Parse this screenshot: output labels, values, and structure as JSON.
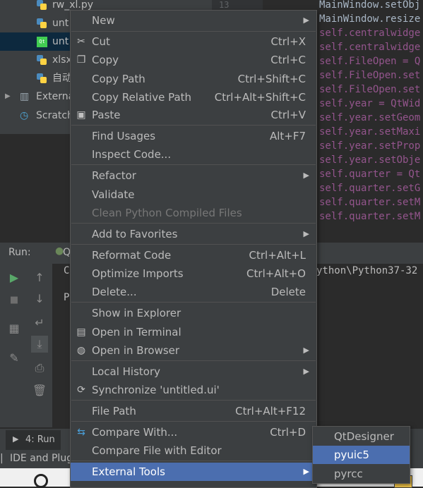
{
  "project_tree": {
    "items": [
      {
        "label": "rw_xl.py"
      },
      {
        "label": "unt"
      },
      {
        "label": "unt"
      },
      {
        "label": "xlsx"
      },
      {
        "label": "自动"
      },
      {
        "label": "Externa"
      },
      {
        "label": "Scratch"
      }
    ]
  },
  "editor": {
    "line_number": "13",
    "lines": [
      "MainWindow.setObj",
      "MainWindow.resize",
      "self.centralwidge",
      "self.centralwidge",
      "self.FileOpen = Q",
      "self.FileOpen.set",
      "self.FileOpen.set",
      "self.year = QtWid",
      "self.year.setGeom",
      "self.year.setMaxi",
      "self.year.setProp",
      "self.year.setObje",
      "self.quarter = Qt",
      "self.quarter.setG",
      "self.quarter.setM",
      "self.quarter.setM"
    ]
  },
  "run_panel": {
    "label": "Run:",
    "tab": "Q",
    "console_line1": "C",
    "console_path": "ython\\Python37-32",
    "console_line2": "P"
  },
  "bottom_bar": {
    "run_tab": "4: Run"
  },
  "status_bar": {
    "text": "IDE and Plug"
  },
  "context_menu": {
    "items": [
      {
        "label": "New",
        "shortcut": "",
        "submenu": true
      },
      {
        "label": "Cut",
        "shortcut": "Ctrl+X",
        "icon": "scissors-icon"
      },
      {
        "label": "Copy",
        "shortcut": "Ctrl+C",
        "icon": "copy-icon"
      },
      {
        "label": "Copy Path",
        "shortcut": "Ctrl+Shift+C"
      },
      {
        "label": "Copy Relative Path",
        "shortcut": "Ctrl+Alt+Shift+C"
      },
      {
        "label": "Paste",
        "shortcut": "Ctrl+V",
        "icon": "paste-icon"
      },
      {
        "label": "Find Usages",
        "shortcut": "Alt+F7"
      },
      {
        "label": "Inspect Code...",
        "shortcut": ""
      },
      {
        "label": "Refactor",
        "shortcut": "",
        "submenu": true
      },
      {
        "label": "Validate",
        "shortcut": ""
      },
      {
        "label": "Clean Python Compiled Files",
        "shortcut": "",
        "disabled": true
      },
      {
        "label": "Add to Favorites",
        "shortcut": "",
        "submenu": true
      },
      {
        "label": "Reformat Code",
        "shortcut": "Ctrl+Alt+L"
      },
      {
        "label": "Optimize Imports",
        "shortcut": "Ctrl+Alt+O"
      },
      {
        "label": "Delete...",
        "shortcut": "Delete"
      },
      {
        "label": "Show in Explorer",
        "shortcut": ""
      },
      {
        "label": "Open in Terminal",
        "shortcut": "",
        "icon": "terminal-icon"
      },
      {
        "label": "Open in Browser",
        "shortcut": "",
        "submenu": true,
        "icon": "globe-icon"
      },
      {
        "label": "Local History",
        "shortcut": "",
        "submenu": true
      },
      {
        "label": "Synchronize 'untitled.ui'",
        "shortcut": "",
        "icon": "sync-icon"
      },
      {
        "label": "File Path",
        "shortcut": "Ctrl+Alt+F12"
      },
      {
        "label": "Compare With...",
        "shortcut": "Ctrl+D",
        "icon": "compare-icon"
      },
      {
        "label": "Compare File with Editor",
        "shortcut": ""
      },
      {
        "label": "External Tools",
        "shortcut": "",
        "submenu": true,
        "highlighted": true
      }
    ]
  },
  "submenu": {
    "items": [
      {
        "label": "QtDesigner"
      },
      {
        "label": "pyuic5",
        "highlighted": true
      },
      {
        "label": "pyrcc"
      }
    ]
  },
  "colors": {
    "menu_bg": "#3c3f41",
    "highlight": "#4b6eaf",
    "editor_bg": "#2b2b2b",
    "keyword_purple": "#94558d"
  }
}
